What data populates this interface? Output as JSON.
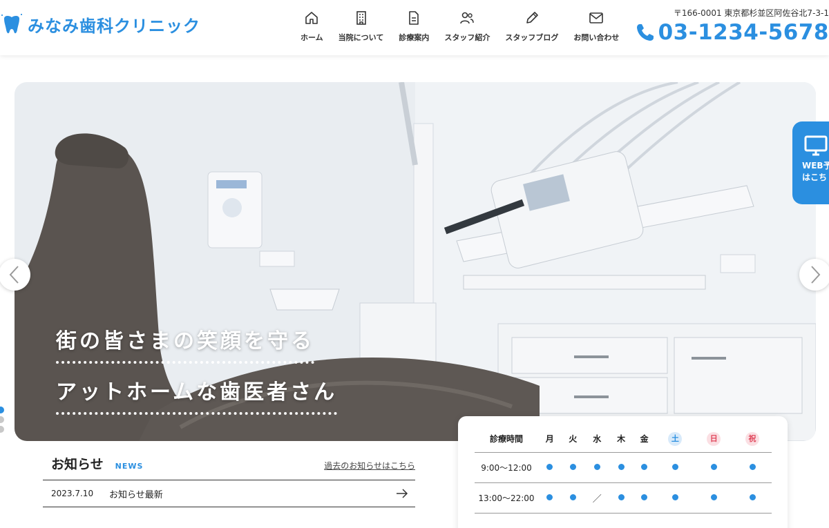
{
  "header": {
    "logo_text": "みなみ歯科クリニック",
    "logo_icon": "tooth-icon",
    "nav": [
      {
        "label": "ホーム",
        "icon": "home-icon"
      },
      {
        "label": "当院について",
        "icon": "building-icon"
      },
      {
        "label": "診療案内",
        "icon": "document-icon"
      },
      {
        "label": "スタッフ紹介",
        "icon": "staff-icon"
      },
      {
        "label": "スタッフブログ",
        "icon": "pen-icon"
      },
      {
        "label": "お問い合わせ",
        "icon": "mail-icon"
      }
    ],
    "address": "〒166-0001 東京都杉並区阿佐谷北7-3-1",
    "phone": "03-1234-5678",
    "phone_icon": "phone-icon"
  },
  "hero": {
    "catch_line1": "街の皆さまの笑顔を守る",
    "catch_line2": "アットホームな歯医者さん",
    "slide_count": 3,
    "active_slide": 1
  },
  "web_tab": {
    "text": "WEB予約はこちら",
    "line1": "WEB予",
    "line2": "はこち",
    "icon": "monitor-icon"
  },
  "news": {
    "title": "お知らせ",
    "subtitle": "NEWS",
    "more_link": "過去のお知らせはこちら",
    "items": [
      {
        "date": "2023.7.10",
        "text": "お知らせ最新"
      }
    ]
  },
  "schedule": {
    "header_label": "診療時間",
    "days": [
      "月",
      "火",
      "水",
      "木",
      "金",
      "土",
      "日",
      "祝"
    ],
    "rows": [
      {
        "time": "9:00〜12:00",
        "marks": [
          "●",
          "●",
          "●",
          "●",
          "●",
          "●",
          "●",
          "●"
        ]
      },
      {
        "time": "13:00〜22:00",
        "marks": [
          "●",
          "●",
          "／",
          "●",
          "●",
          "●",
          "●",
          "●"
        ]
      }
    ],
    "colors": {
      "accent": "#2b8fe0",
      "sat_bg": "#d8eafa",
      "sun_bg": "#fbdfe3",
      "sun_text": "#e0455a"
    }
  }
}
